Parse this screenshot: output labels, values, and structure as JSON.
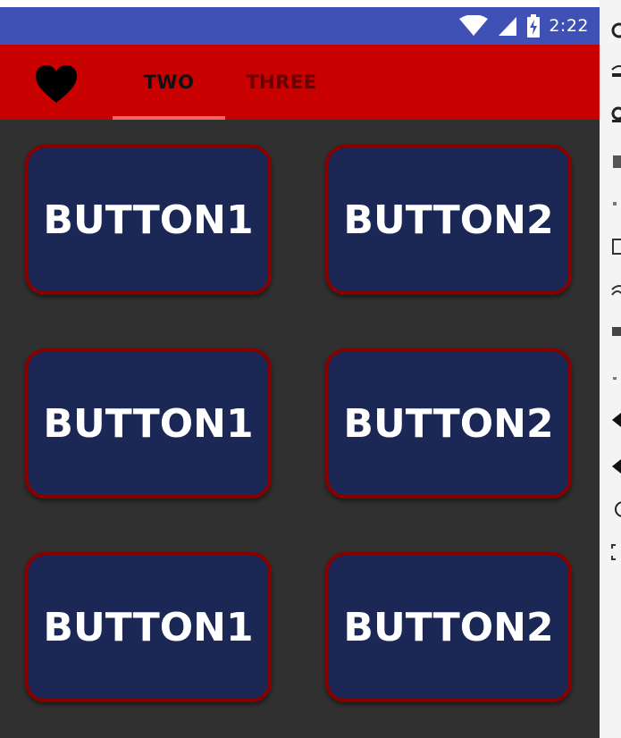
{
  "status_bar": {
    "time": "2:22",
    "icons": [
      "wifi-icon",
      "cell-signal-icon",
      "battery-charging-icon"
    ],
    "background": "#3f51b5"
  },
  "app_bar": {
    "background": "#c80000",
    "tab_icon": "heart-icon",
    "tabs": [
      {
        "label": "TWO",
        "selected": true
      },
      {
        "label": "THREE",
        "selected": false
      }
    ],
    "indicator_color": "#ff6060"
  },
  "buttons": [
    {
      "label": "BUTTON1"
    },
    {
      "label": "BUTTON2"
    },
    {
      "label": "BUTTON1"
    },
    {
      "label": "BUTTON2"
    },
    {
      "label": "BUTTON1"
    },
    {
      "label": "BUTTON2"
    }
  ],
  "colors": {
    "screen_background": "#303030",
    "button_fill": "#1b2754",
    "button_border": "#870000"
  },
  "emulator_toolbar": {
    "icons": [
      "power-icon",
      "gps-icon",
      "camera-icon",
      "delete-icon",
      "volume-up-icon",
      "battery-icon",
      "wifi-icon",
      "phone-icon",
      "dpad-icon",
      "volume-down-icon",
      "rotate-icon",
      "back-icon",
      "screenshot-icon",
      "zoom-icon"
    ]
  }
}
